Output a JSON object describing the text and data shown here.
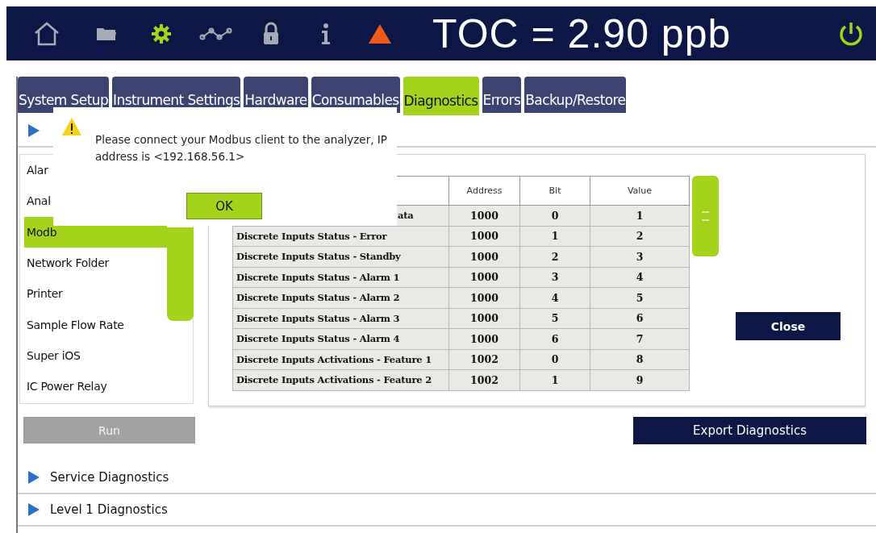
{
  "top_bar": {
    "nav_icons": [
      {
        "kind": "home",
        "selected": false
      },
      {
        "kind": "folder",
        "selected": false
      },
      {
        "kind": "gear",
        "selected": true
      },
      {
        "kind": "trend",
        "selected": false
      },
      {
        "kind": "lock",
        "selected": false
      },
      {
        "kind": "info",
        "selected": false
      }
    ],
    "title": "TOC = 2.90 ppb"
  },
  "tabs": [
    {
      "label": "System Setup",
      "selected": false
    },
    {
      "label": "Instrument Settings",
      "selected": false
    },
    {
      "label": "Hardware",
      "selected": false
    },
    {
      "label": "Consumables",
      "selected": false
    },
    {
      "label": "Diagnostics",
      "selected": true
    },
    {
      "label": "Errors",
      "selected": false
    },
    {
      "label": "Backup/Restore",
      "selected": false
    }
  ],
  "sidebar": {
    "items": [
      {
        "label": "Alar",
        "selected": false
      },
      {
        "label": "Anal",
        "selected": false
      },
      {
        "label": "Modb",
        "selected": true
      },
      {
        "label": "Network Folder",
        "selected": false
      },
      {
        "label": "Printer",
        "selected": false
      },
      {
        "label": "Sample Flow Rate",
        "selected": false
      },
      {
        "label": "Super iOS",
        "selected": false
      },
      {
        "label": "IC Power Relay",
        "selected": false
      }
    ]
  },
  "table": {
    "columns": [
      "Address",
      "Bit",
      "Value"
    ],
    "rows": [
      {
        "name": "ata",
        "cut_left": true,
        "address": "1000",
        "bit": "0",
        "value": "1"
      },
      {
        "name": "Discrete Inputs Status - Error",
        "cut_left": false,
        "address": "1000",
        "bit": "1",
        "value": "2"
      },
      {
        "name": "Discrete Inputs Status - Standby",
        "cut_left": false,
        "address": "1000",
        "bit": "2",
        "value": "3"
      },
      {
        "name": "Discrete Inputs Status - Alarm 1",
        "cut_left": false,
        "address": "1000",
        "bit": "3",
        "value": "4"
      },
      {
        "name": "Discrete Inputs Status - Alarm 2",
        "cut_left": false,
        "address": "1000",
        "bit": "4",
        "value": "5"
      },
      {
        "name": "Discrete Inputs Status - Alarm 3",
        "cut_left": false,
        "address": "1000",
        "bit": "5",
        "value": "6"
      },
      {
        "name": "Discrete Inputs Status - Alarm 4",
        "cut_left": false,
        "address": "1000",
        "bit": "6",
        "value": "7"
      },
      {
        "name": "Discrete Inputs Activations - Feature 1",
        "cut_left": false,
        "address": "1002",
        "bit": "0",
        "value": "8"
      },
      {
        "name": "Discrete Inputs Activations - Feature 2",
        "cut_left": false,
        "address": "1002",
        "bit": "1",
        "value": "9"
      }
    ]
  },
  "close_button": "Close",
  "run_button": {
    "label": "Run",
    "disabled": true
  },
  "export_button": "Export Diagnostics",
  "sections": [
    "Service Diagnostics",
    "Level 1 Diagnostics"
  ],
  "dialog": {
    "message": "Please connect your Modbus client to the analyzer, IP address is <192.168.56.1>",
    "ok_label": "OK"
  }
}
